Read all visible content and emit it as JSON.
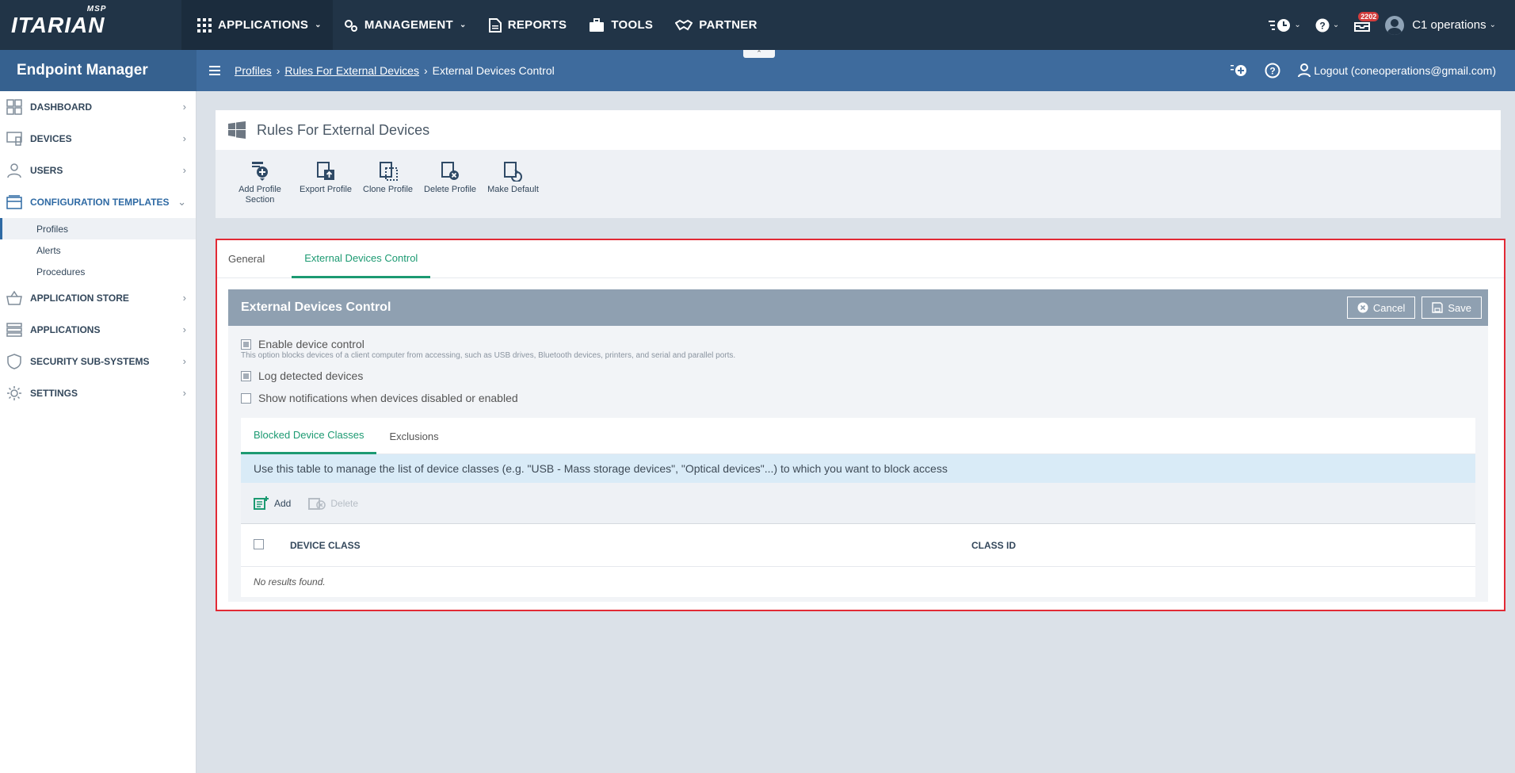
{
  "brand": {
    "logo_text": "ITARIAN",
    "logo_badge": "MSP"
  },
  "topnav": {
    "applications": "APPLICATIONS",
    "management": "MANAGEMENT",
    "reports": "REPORTS",
    "tools": "TOOLS",
    "partner": "PARTNER"
  },
  "topright": {
    "notifications_count": "2202",
    "user": "C1 operations"
  },
  "subbar": {
    "app_title": "Endpoint Manager",
    "breadcrumb": [
      "Profiles",
      "Rules For External Devices",
      "External Devices Control"
    ],
    "logout": "Logout (coneoperations@gmail.com)"
  },
  "sidebar": {
    "items": [
      {
        "label": "DASHBOARD"
      },
      {
        "label": "DEVICES"
      },
      {
        "label": "USERS"
      },
      {
        "label": "CONFIGURATION TEMPLATES"
      },
      {
        "label": "APPLICATION STORE"
      },
      {
        "label": "APPLICATIONS"
      },
      {
        "label": "SECURITY SUB-SYSTEMS"
      },
      {
        "label": "SETTINGS"
      }
    ],
    "subitems": [
      "Profiles",
      "Alerts",
      "Procedures"
    ]
  },
  "page": {
    "title": "Rules For External Devices"
  },
  "toolbar": {
    "add_profile_section": "Add Profile Section",
    "export_profile": "Export Profile",
    "clone_profile": "Clone Profile",
    "delete_profile": "Delete Profile",
    "make_default": "Make Default"
  },
  "tabs": [
    "General",
    "External Devices Control"
  ],
  "section": {
    "title": "External Devices Control",
    "cancel": "Cancel",
    "save": "Save",
    "options": [
      {
        "label": "Enable device control",
        "checked": true
      },
      {
        "label": "Log detected devices",
        "checked": true
      },
      {
        "label": "Show notifications when devices disabled or enabled",
        "checked": false
      }
    ],
    "option_desc": "This option blocks devices of a client computer from accessing, such as USB drives, Bluetooth devices, printers, and serial and parallel ports."
  },
  "inner": {
    "tabs": [
      "Blocked Device Classes",
      "Exclusions"
    ],
    "info": "Use this table to manage the list of device classes (e.g. \"USB - Mass storage devices\", \"Optical devices\"...) to which you want to block access",
    "add": "Add",
    "delete": "Delete",
    "columns": [
      "DEVICE CLASS",
      "CLASS ID"
    ],
    "empty": "No results found."
  },
  "colors": {
    "topbar": "#213447",
    "subbar": "#3e6b9d",
    "accent": "#1c9a72",
    "highlight_border": "#e22a35"
  }
}
